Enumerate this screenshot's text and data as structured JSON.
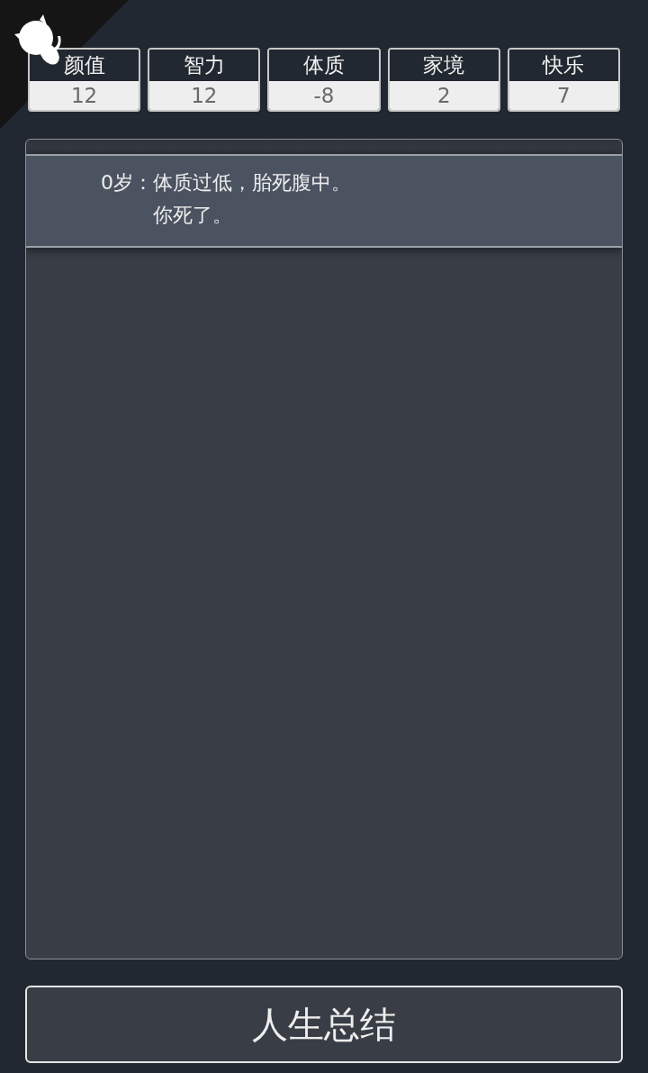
{
  "properties": [
    {
      "label": "颜值",
      "value": "12"
    },
    {
      "label": "智力",
      "value": "12"
    },
    {
      "label": "体质",
      "value": "-8"
    },
    {
      "label": "家境",
      "value": "2"
    },
    {
      "label": "快乐",
      "value": "7"
    }
  ],
  "trajectory": [
    {
      "age": "0岁：",
      "texts": [
        "体质过低，胎死腹中。",
        "你死了。"
      ]
    }
  ],
  "summary_button": {
    "label": "人生总结"
  }
}
